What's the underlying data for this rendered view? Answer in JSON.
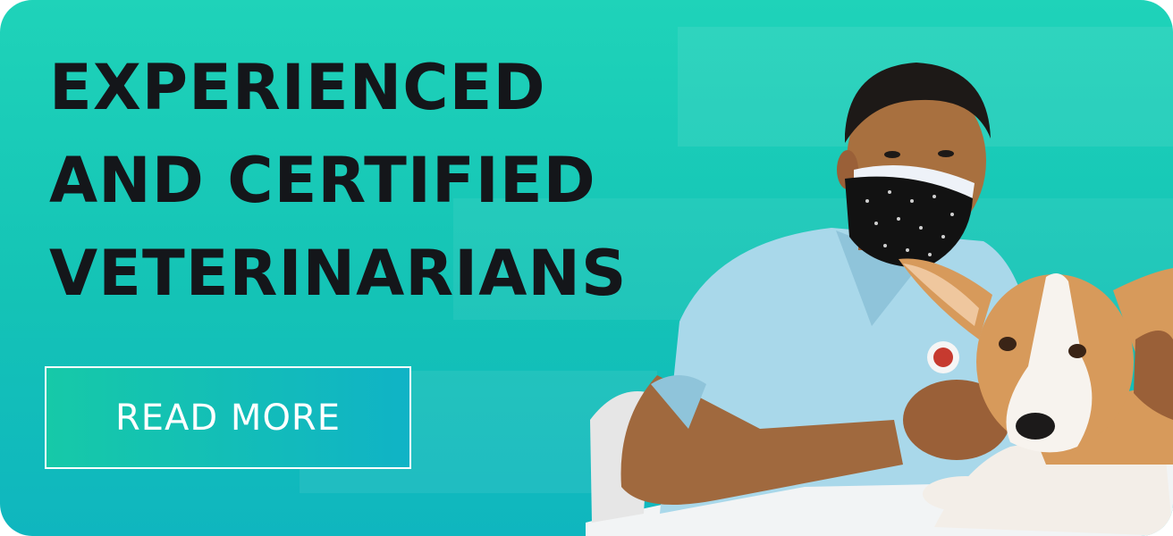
{
  "banner": {
    "headline": [
      "EXPERIENCED",
      "AND CERTIFIED",
      "VETERINARIANS"
    ],
    "cta_label": "READ MORE"
  },
  "colors": {
    "background_top": "#1fd3b9",
    "background_bottom": "#0fb6bf",
    "headline_text": "#14161a",
    "button_border": "#ffffff",
    "scrubs": "#a9d8ea",
    "puppy_fur": "#d79a5b"
  },
  "photo": {
    "subject": "veterinarian-with-corgi-puppy-icon"
  }
}
